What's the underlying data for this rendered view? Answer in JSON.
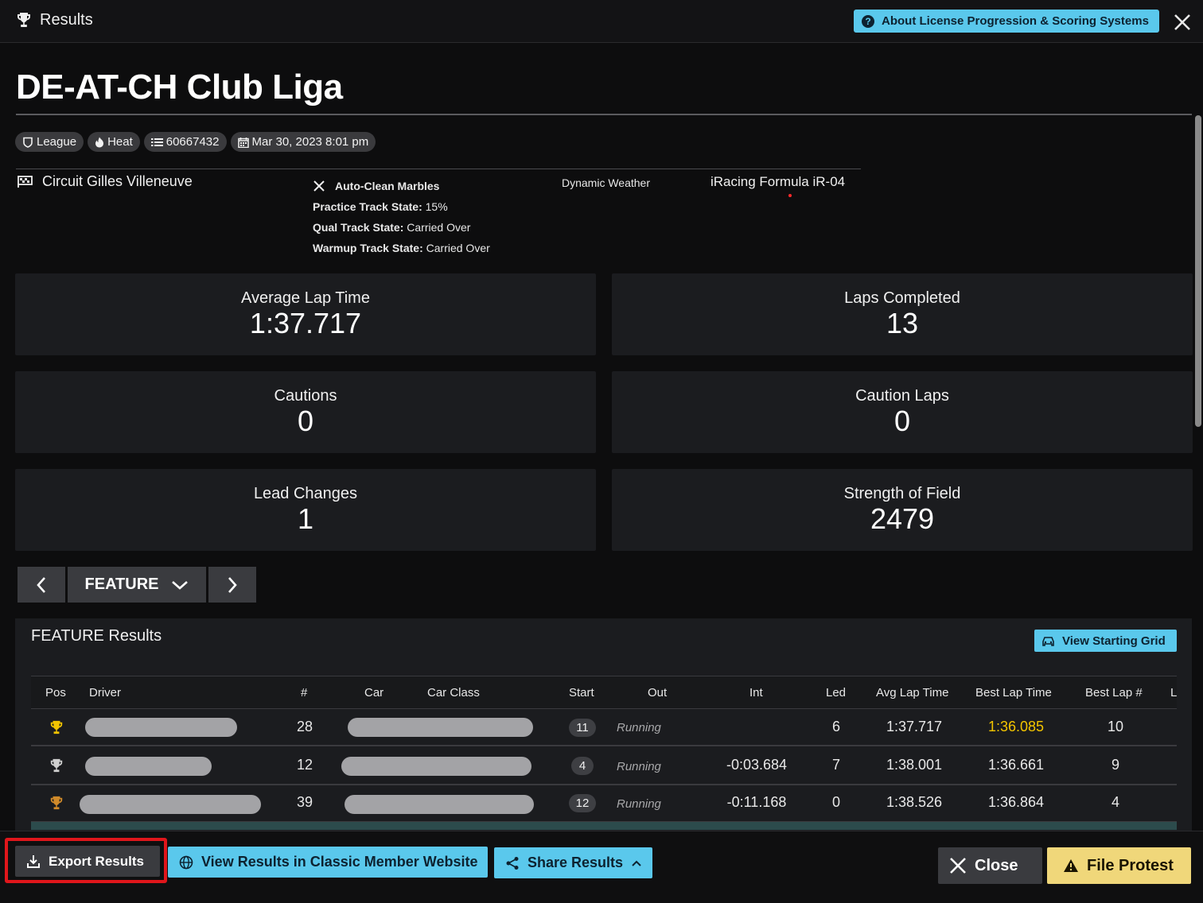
{
  "window": {
    "title": "Results",
    "about_label": "About License Progression & Scoring Systems"
  },
  "event": {
    "name": "DE-AT-CH Club Liga",
    "chips": [
      {
        "icon": "shield-icon",
        "label": "League"
      },
      {
        "icon": "flame-icon",
        "label": "Heat"
      },
      {
        "icon": "list-icon",
        "label": "60667432"
      },
      {
        "icon": "calendar-icon",
        "label": "Mar 30, 2023 8:01 pm"
      }
    ]
  },
  "session": {
    "track": "Circuit Gilles Villeneuve",
    "auto_clean_label": "Auto-Clean Marbles",
    "practice_label": "Practice Track State:",
    "practice_value": "15%",
    "qual_label": "Qual Track State:",
    "qual_value": "Carried Over",
    "warmup_label": "Warmup Track State:",
    "warmup_value": "Carried Over",
    "weather": "Dynamic Weather",
    "car": "iRacing Formula iR-04"
  },
  "stats": [
    {
      "label": "Average Lap Time",
      "value": "1:37.717"
    },
    {
      "label": "Laps Completed",
      "value": "13"
    },
    {
      "label": "Cautions",
      "value": "0"
    },
    {
      "label": "Caution Laps",
      "value": "0"
    },
    {
      "label": "Lead Changes",
      "value": "1"
    },
    {
      "label": "Strength of Field",
      "value": "2479"
    }
  ],
  "session_nav": {
    "current": "FEATURE"
  },
  "results": {
    "title": "FEATURE Results",
    "view_grid_label": "View Starting Grid",
    "columns": [
      "Pos",
      "Driver",
      "#",
      "Car",
      "Car Class",
      "Start",
      "Out",
      "Int",
      "Led",
      "Avg Lap Time",
      "Best Lap Time",
      "Best Lap #",
      "L"
    ],
    "rows": [
      {
        "trophy": "gold",
        "number": "28",
        "start": "11",
        "out": "Running",
        "int": "",
        "led": "6",
        "avg": "1:37.717",
        "best": "1:36.085",
        "best_lap": "10"
      },
      {
        "trophy": "silver",
        "number": "12",
        "start": "4",
        "out": "Running",
        "int": "-0:03.684",
        "led": "7",
        "avg": "1:38.001",
        "best": "1:36.661",
        "best_lap": "9"
      },
      {
        "trophy": "bronze",
        "number": "39",
        "start": "12",
        "out": "Running",
        "int": "-0:11.168",
        "led": "0",
        "avg": "1:38.526",
        "best": "1:36.864",
        "best_lap": "4"
      }
    ],
    "colors": {
      "fastest_lap": "#f2c400",
      "gold": "#f2c400",
      "silver": "#cfcfcf",
      "bronze": "#d08a2a"
    }
  },
  "footer": {
    "export_label": "Export Results",
    "classic_label": "View Results in Classic Member Website",
    "share_label": "Share Results",
    "close_label": "Close",
    "protest_label": "File Protest"
  },
  "colors": {
    "accent": "#5ac8ec",
    "warning": "#f0d77a",
    "highlight": "#e0161b"
  }
}
